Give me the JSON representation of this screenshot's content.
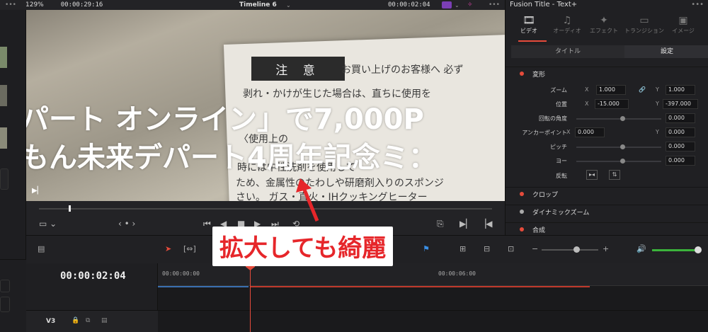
{
  "topbar": {
    "zoom": "129%",
    "source_timecode": "00:00:29:16",
    "timeline_name": "Timeline 6",
    "timeline_timecode": "00:00:02:04"
  },
  "viewer": {
    "caution_label": "注 意",
    "paper_lines": [
      "お買い上げのお客様へ 必ず",
      "剥れ・かけが生じた場合は、直ちに使用を",
      "〈使用上の",
      "時には中性洗剤を使用して",
      "ため、金属性のたわしや研磨剤入りのスポンジ",
      "さい。 ガス・直火・IHクッキングヒーター"
    ],
    "overlay_line1": "パート オンライン」で7,000P",
    "overlay_line2": "もん未来デパート4周年記念ミ："
  },
  "inspector": {
    "title": "Fusion Title - Text+",
    "tabs": [
      {
        "label": "ビデオ",
        "icon": "🎞"
      },
      {
        "label": "オーディオ",
        "icon": "♫"
      },
      {
        "label": "エフェクト",
        "icon": "✦"
      },
      {
        "label": "トランジション",
        "icon": "▭"
      },
      {
        "label": "イメージ",
        "icon": "▣"
      }
    ],
    "subtabs": [
      "タイトル",
      "設定"
    ],
    "section_transform": "変形",
    "zoom_label": "ズーム",
    "zoom_x": "1.000",
    "zoom_y": "1.000",
    "position_label": "位置",
    "position_x": "-15.000",
    "position_y": "-397.000",
    "rotation_label": "回転の角度",
    "rotation_value": "0.000",
    "anchor_label": "アンカーポイント",
    "anchor_x": "0.000",
    "anchor_y": "0.000",
    "pitch_label": "ピッチ",
    "pitch_value": "0.000",
    "yaw_label": "ヨー",
    "yaw_value": "0.000",
    "flip_label": "反転",
    "axis_x": "X",
    "axis_y": "Y",
    "section_crop": "クロップ",
    "section_dynamic_zoom": "ダイナミックズーム",
    "section_composite": "合成"
  },
  "timeline": {
    "timecode": "00:00:02:04",
    "ruler_start": "00:00:00:00",
    "ruler_mid": "00:00:06:00",
    "track_label": "V3"
  },
  "annotation": {
    "text": "拡大しても綺麗"
  },
  "colors": {
    "accent_red": "#e64b3b",
    "annotation_red": "#e6262a",
    "volume_green": "#3bb33b"
  }
}
